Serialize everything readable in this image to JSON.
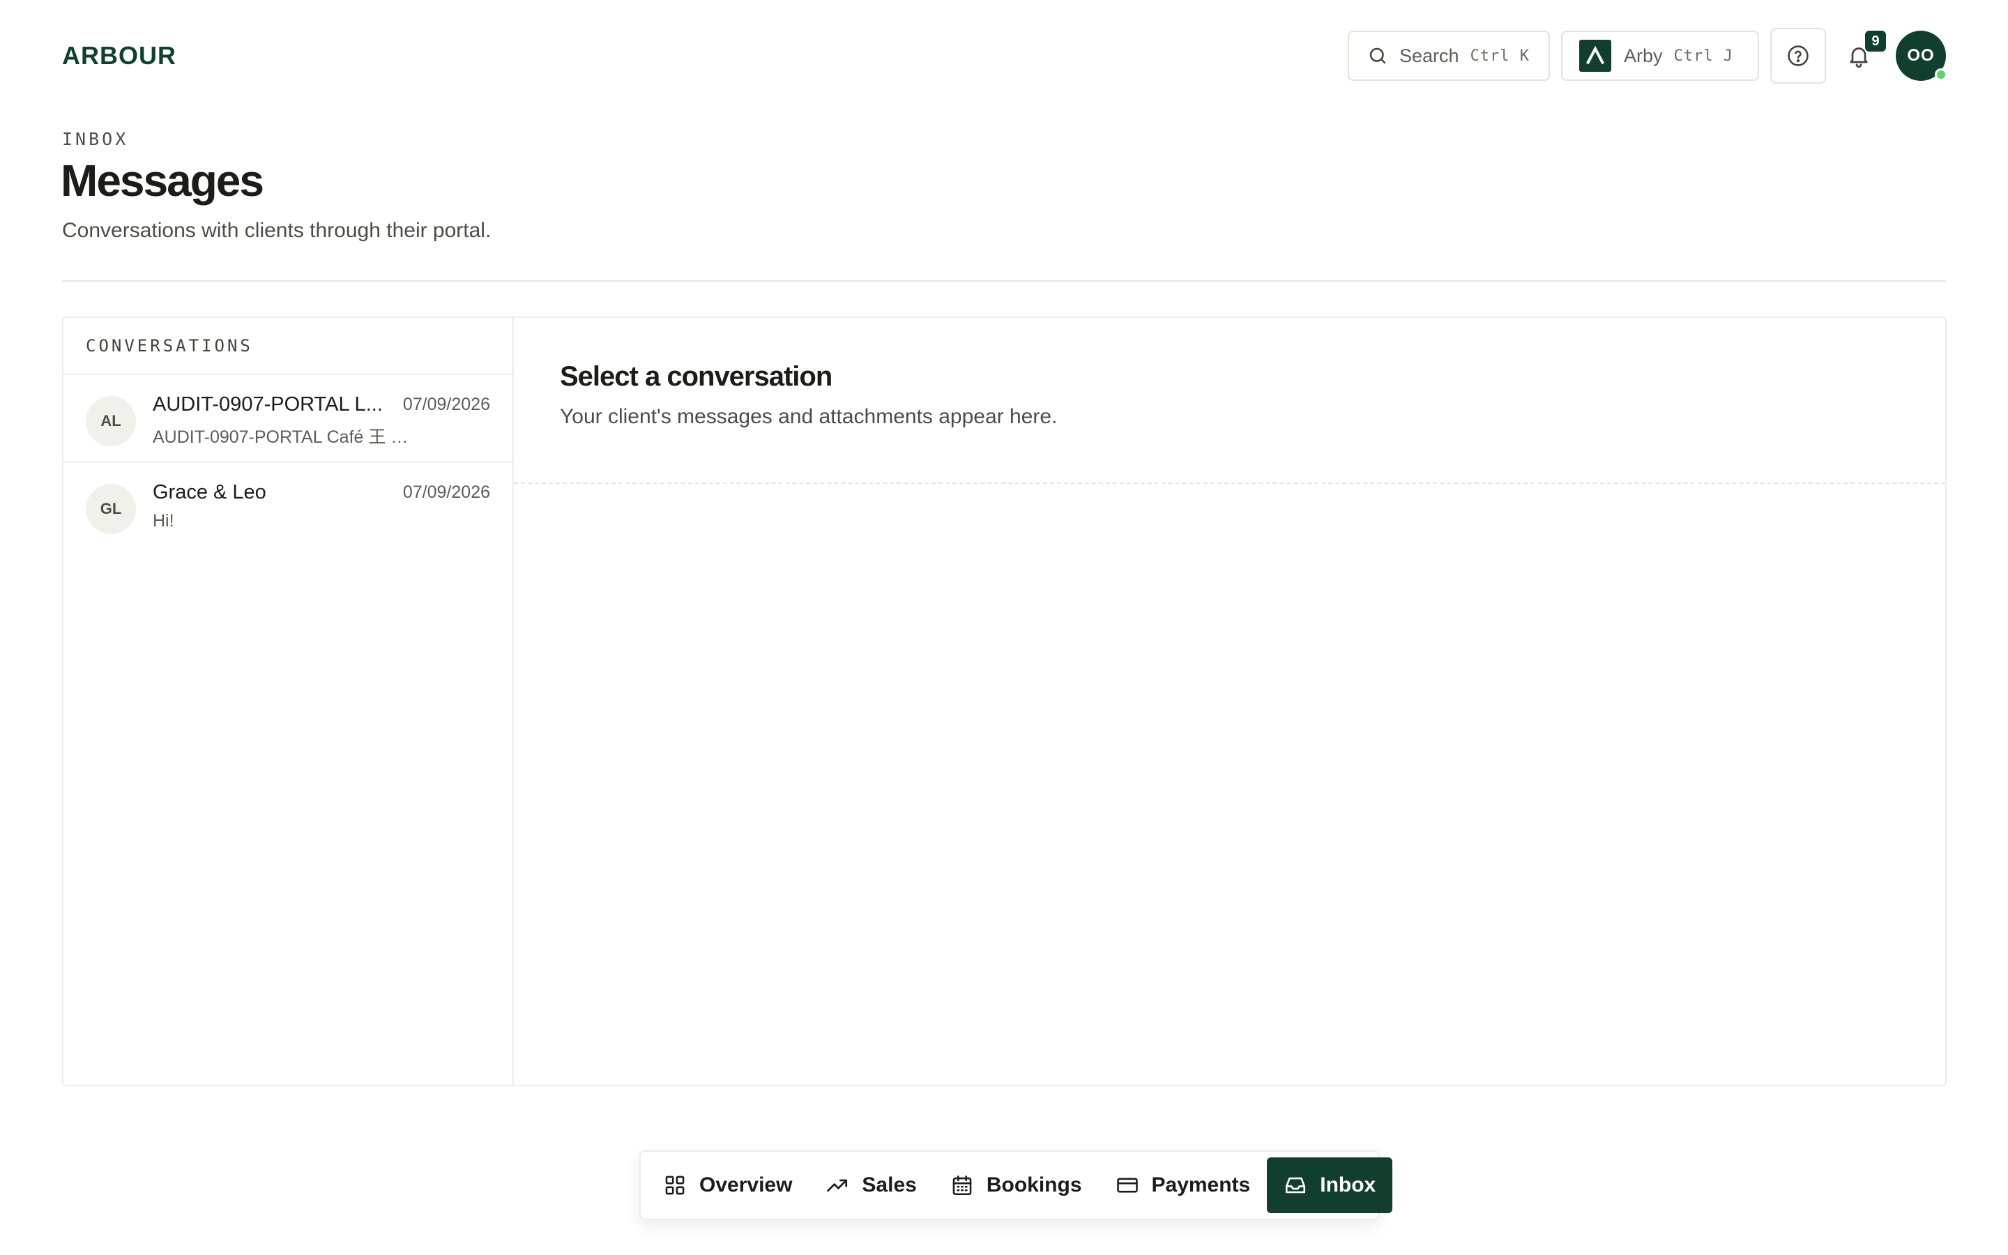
{
  "header": {
    "logo": "ARBOUR",
    "search": {
      "label": "Search",
      "shortcut": "Ctrl K"
    },
    "assistant": {
      "label": "Arby",
      "shortcut": "Ctrl J"
    },
    "notifications": {
      "count": "9"
    },
    "user": {
      "initials": "OO",
      "status_color": "#5fd36a"
    }
  },
  "page": {
    "eyebrow": "INBOX",
    "title": "Messages",
    "subtitle": "Conversations with clients through their portal."
  },
  "conversations": {
    "header": "CONVERSATIONS",
    "items": [
      {
        "initials": "AL",
        "name": "AUDIT-0907-PORTAL L...",
        "date": "07/09/2026",
        "preview": "AUDIT-0907-PORTAL Café 王 🪴 ..."
      },
      {
        "initials": "GL",
        "name": "Grace & Leo",
        "date": "07/09/2026",
        "preview": "Hi!"
      }
    ]
  },
  "detail": {
    "empty_title": "Select a conversation",
    "empty_subtitle": "Your client's messages and attachments appear here."
  },
  "bottom_nav": {
    "items": [
      {
        "label": "Overview",
        "icon": "grid-icon"
      },
      {
        "label": "Sales",
        "icon": "trend-up-icon"
      },
      {
        "label": "Bookings",
        "icon": "calendar-icon"
      },
      {
        "label": "Payments",
        "icon": "credit-card-icon"
      },
      {
        "label": "Inbox",
        "icon": "inbox-icon",
        "active": true
      }
    ]
  },
  "colors": {
    "brand": "#123f2d",
    "border": "#ecece8",
    "text": "#1b1d1a",
    "muted": "#5b5e58"
  }
}
